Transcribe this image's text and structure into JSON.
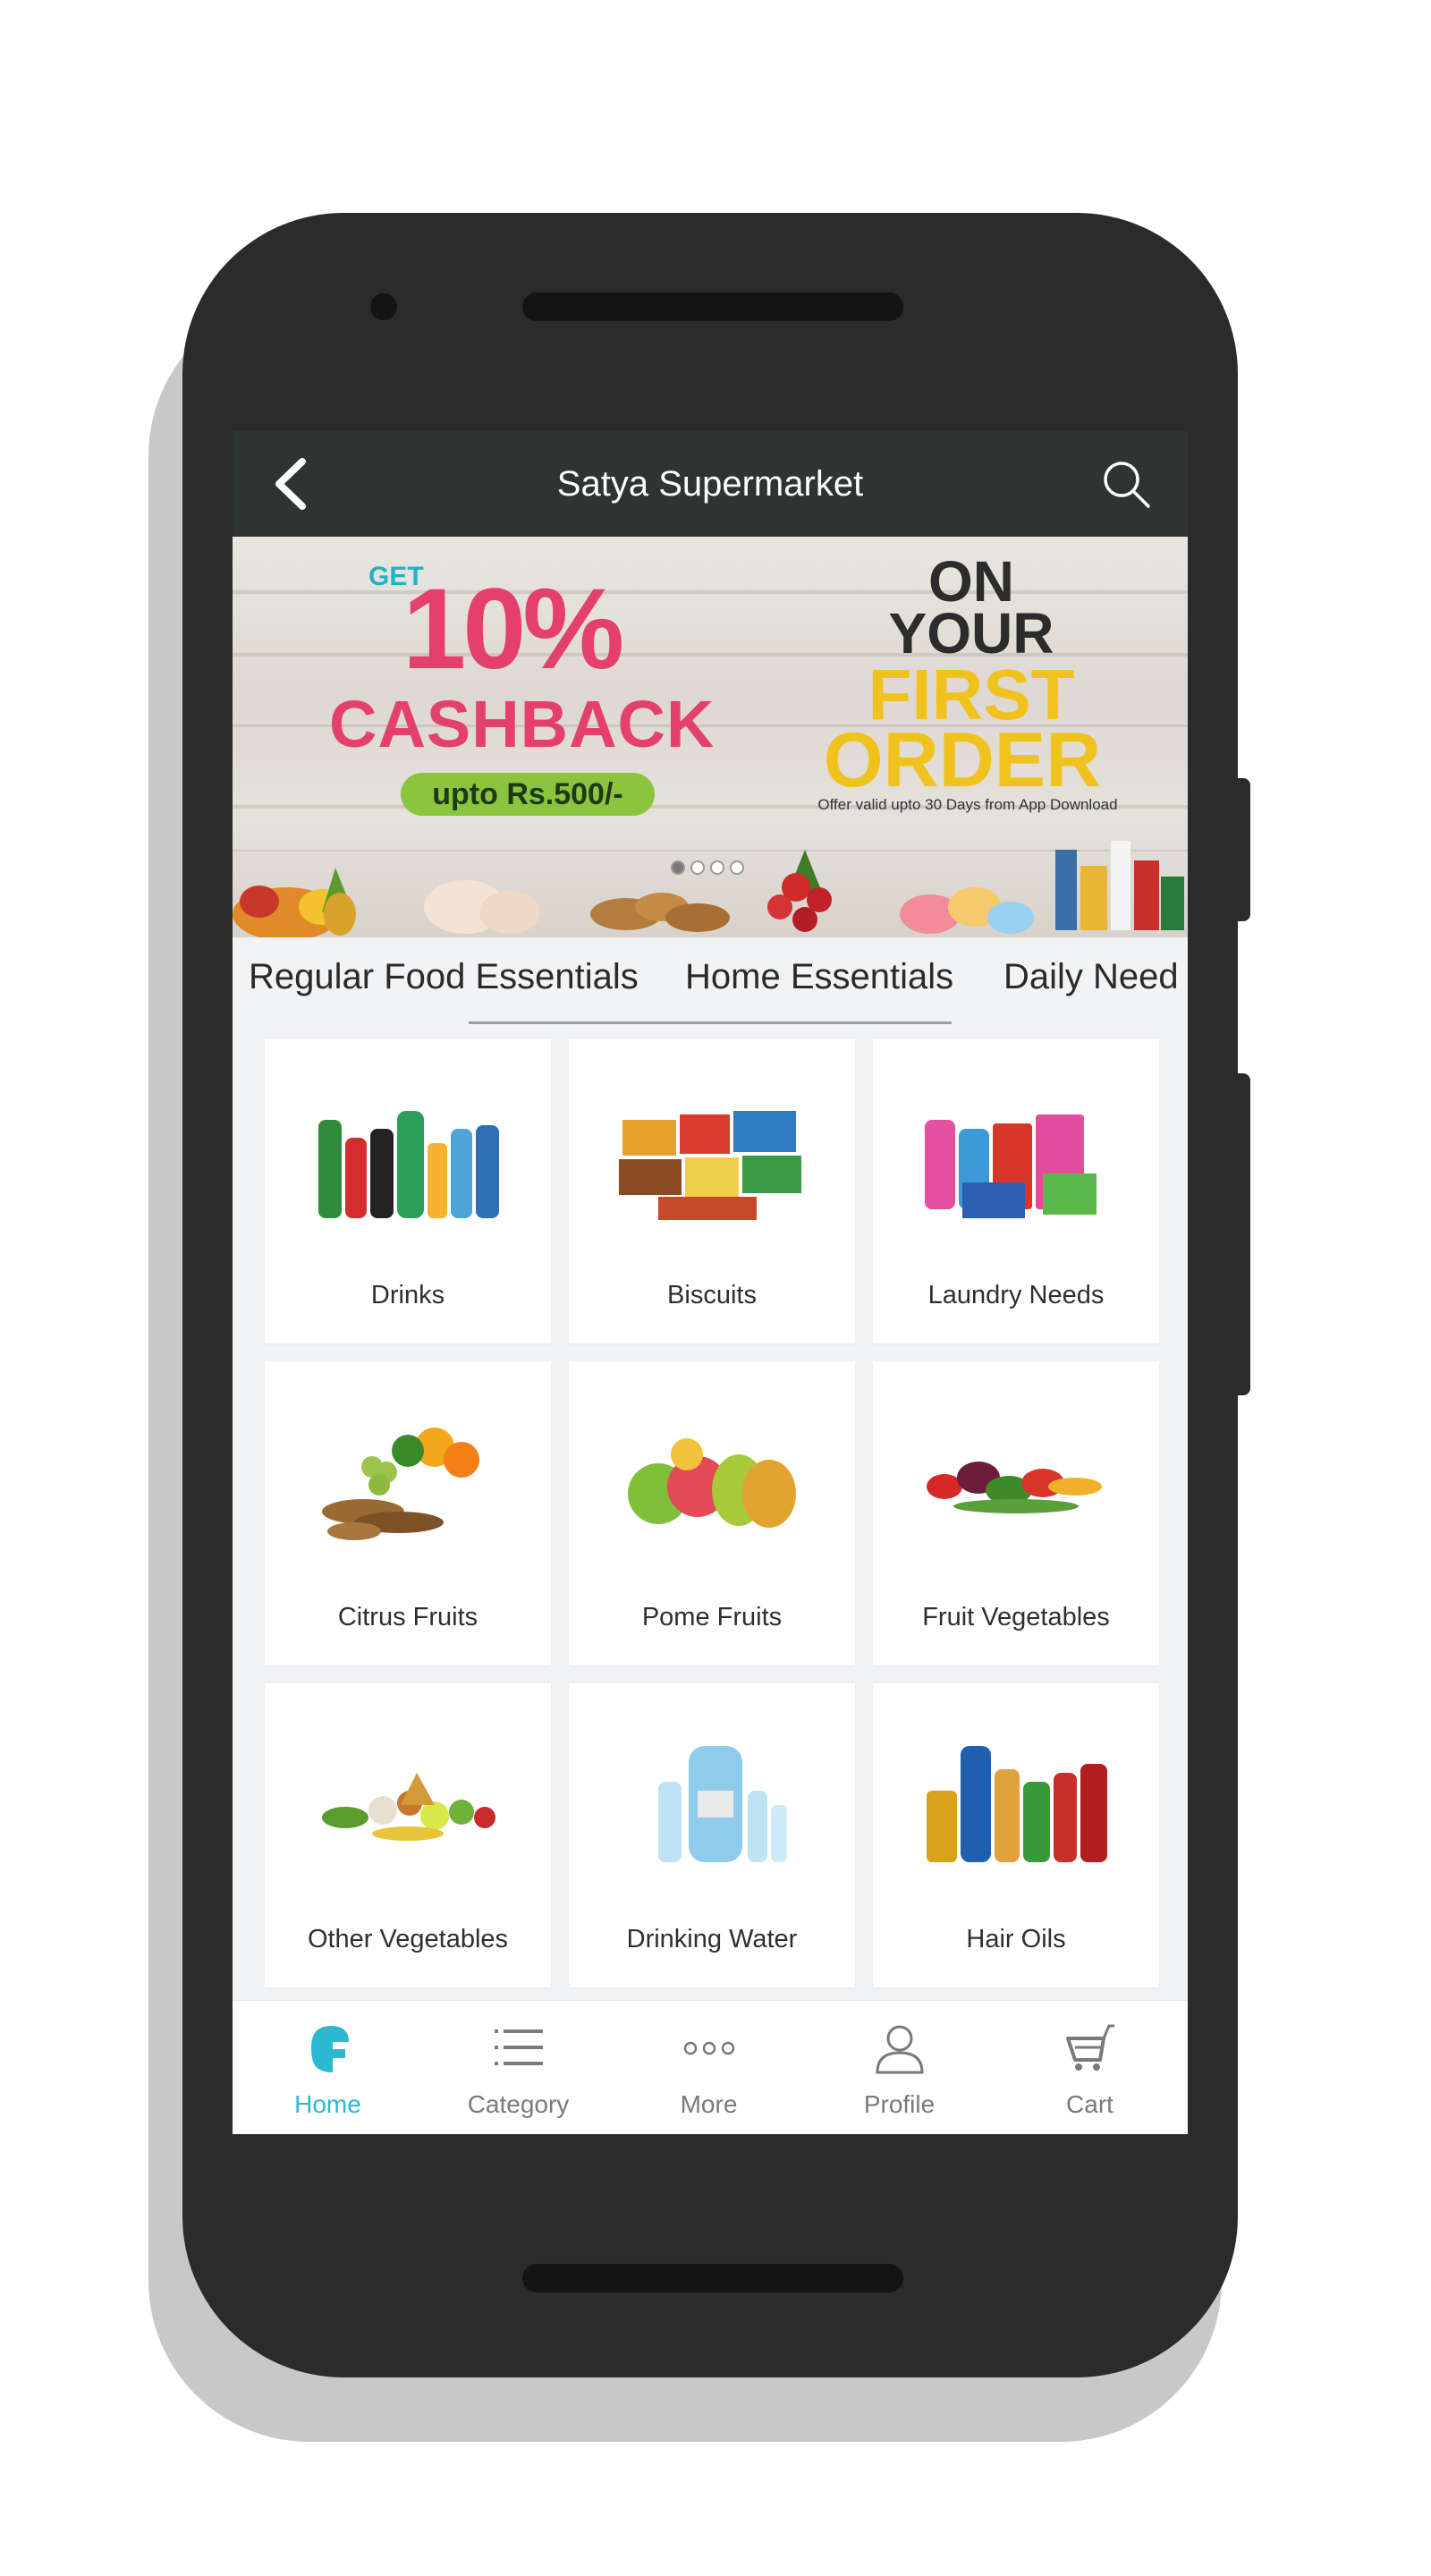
{
  "app": {
    "title": "Satya Supermarket"
  },
  "banner": {
    "get": "GET",
    "percent": "10%",
    "cashback": "CASHBACK",
    "upto": "upto Rs.500/-",
    "on": "ON",
    "your": "YOUR",
    "first": "FIRST",
    "order": "ORDER",
    "offer_note": "Offer valid upto 30 Days from App Download",
    "slides": 4,
    "active_slide": 1
  },
  "tabs": [
    {
      "label": "Regular Food Essentials"
    },
    {
      "label": "Home Essentials"
    },
    {
      "label": "Daily Need"
    }
  ],
  "active_tab": "Home Essentials",
  "categories": [
    {
      "label": "Drinks",
      "icon": "drinks-image"
    },
    {
      "label": "Biscuits",
      "icon": "biscuits-image"
    },
    {
      "label": "Laundry Needs",
      "icon": "laundry-image"
    },
    {
      "label": "Citrus Fruits",
      "icon": "citrus-fruits-image"
    },
    {
      "label": "Pome Fruits",
      "icon": "pome-fruits-image"
    },
    {
      "label": "Fruit Vegetables",
      "icon": "fruit-vegetables-image"
    },
    {
      "label": "Other Vegetables",
      "icon": "other-vegetables-image"
    },
    {
      "label": "Drinking Water",
      "icon": "drinking-water-image"
    },
    {
      "label": "Hair Oils",
      "icon": "hair-oils-image"
    }
  ],
  "bottom_nav": [
    {
      "label": "Home",
      "icon": "home-icon",
      "active": true
    },
    {
      "label": "Category",
      "icon": "list-icon",
      "active": false
    },
    {
      "label": "More",
      "icon": "more-icon",
      "active": false
    },
    {
      "label": "Profile",
      "icon": "user-icon",
      "active": false
    },
    {
      "label": "Cart",
      "icon": "cart-icon",
      "active": false
    }
  ],
  "colors": {
    "appbar": "#2e3431",
    "accent": "#2bb8d0",
    "cashback_pink": "#e4406c",
    "order_yellow": "#f0c21e",
    "upto_green": "#8bc43f"
  }
}
